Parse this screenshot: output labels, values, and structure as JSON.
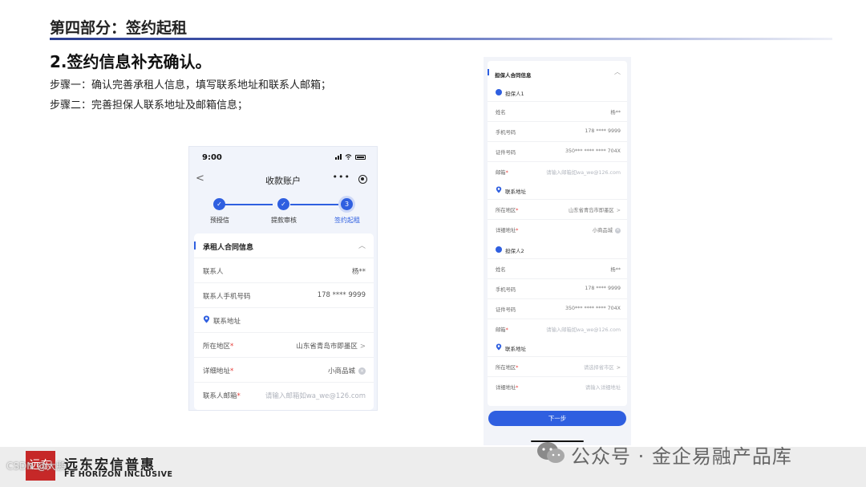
{
  "slide": {
    "section_title": "第四部分：签约起租",
    "heading": "2.签约信息补充确认。",
    "steps": [
      "步骤一：确认完善承租人信息，填写联系地址和联系人邮箱；",
      "步骤二：完善担保人联系地址及邮箱信息；"
    ]
  },
  "phone": {
    "time": "9:00",
    "nav_back": "<",
    "nav_title": "收款账户",
    "nav_more": "•••",
    "stepper": [
      {
        "label": "预授信",
        "mark": "✓"
      },
      {
        "label": "提款审核",
        "mark": "✓"
      },
      {
        "label": "签约起租",
        "mark": "3"
      }
    ],
    "card": {
      "title": "承租人合同信息",
      "collapse": "︿",
      "rows": [
        {
          "label": "联系人",
          "value": "杨**"
        },
        {
          "label": "联系人手机号码",
          "value": "178 **** 9999"
        }
      ],
      "address_header": "联系地址",
      "region": {
        "label": "所在地区",
        "required": "*",
        "value": "山东省青岛市即墨区",
        "arrow": ">"
      },
      "detail": {
        "label": "详细地址",
        "required": "*",
        "value": "小商品城",
        "clear": "×"
      },
      "email": {
        "label": "联系人邮箱",
        "required": "*",
        "placeholder": "请输入邮箱如wa_we@126.com"
      }
    }
  },
  "guarantor_form": {
    "title": "担保人合同信息",
    "collapse": "︿",
    "guarantors": [
      {
        "name_header": "担保人1",
        "name": {
          "label": "姓名",
          "value": "杨**"
        },
        "phone": {
          "label": "手机号码",
          "value": "178 **** 9999"
        },
        "id_no": {
          "label": "证件号码",
          "value": "350*** **** **** 704X"
        },
        "email": {
          "label": "邮箱",
          "required": "*",
          "placeholder": "请输入邮箱如wa_we@126.com"
        },
        "address_header": "联系地址",
        "region": {
          "label": "所在地区",
          "required": "*",
          "value": "山东省青岛市即墨区",
          "arrow": ">"
        },
        "detail": {
          "label": "详细地址",
          "required": "*",
          "value": "小商品城",
          "clear": "×"
        }
      },
      {
        "name_header": "担保人2",
        "name": {
          "label": "姓名",
          "value": "杨**"
        },
        "phone": {
          "label": "手机号码",
          "value": "178 **** 9999"
        },
        "id_no": {
          "label": "证件号码",
          "value": "350*** **** **** 704X"
        },
        "email": {
          "label": "邮箱",
          "required": "*",
          "placeholder": "请输入邮箱如wa_we@126.com"
        },
        "address_header": "联系地址",
        "region": {
          "label": "所在地区",
          "required": "*",
          "placeholder": "请选择省市区",
          "arrow": ">"
        },
        "detail": {
          "label": "详细地址",
          "required": "*",
          "placeholder": "请输入详细地址"
        }
      }
    ],
    "next_button": "下一步"
  },
  "footer": {
    "logo_text": "远东",
    "brand_cn": "远东宏信普惠",
    "brand_en": "FE HORIZON INCLUSIVE",
    "watermark_tag": "CSDN @大鹏",
    "watermark": "公众号 · 金企易融产品库"
  },
  "colors": {
    "accent": "#2f5fe0",
    "required": "#e53935",
    "logo": "#c62828"
  }
}
